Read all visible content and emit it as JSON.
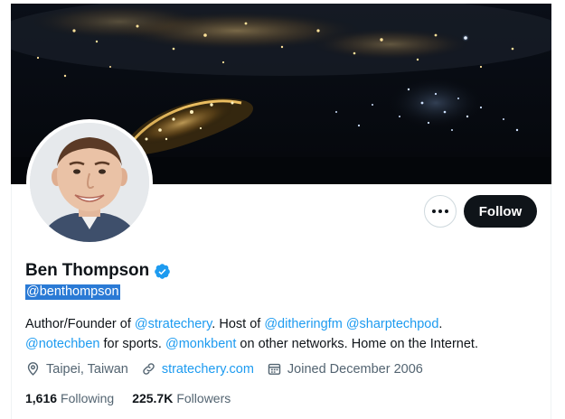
{
  "profile": {
    "display_name": "Ben Thompson",
    "handle": "@benthompson",
    "verified": true,
    "banner_icon": "earth-night-photo",
    "avatar_icon": "profile-photo"
  },
  "actions": {
    "more_label": "More",
    "follow_label": "Follow"
  },
  "bio": {
    "t1": "Author/Founder of ",
    "m1": "@stratechery",
    "t2": ". Host of ",
    "m2": "@ditheringfm",
    "t3": " ",
    "m3": "@sharptechpod",
    "t4": ". ",
    "m4": "@notechben",
    "t5": " for sports. ",
    "m5": "@monkbent",
    "t6": " on other networks. Home on the Internet."
  },
  "meta": {
    "location": "Taipei, Taiwan",
    "website": "stratechery.com",
    "joined": "Joined December 2006"
  },
  "counts": {
    "following_num": "1,616",
    "following_label": "Following",
    "followers_num": "225.7K",
    "followers_label": "Followers"
  },
  "colors": {
    "accent": "#1d9bf0",
    "text_primary": "#0f1419",
    "text_secondary": "#536471",
    "selection": "#2a7ad5"
  }
}
